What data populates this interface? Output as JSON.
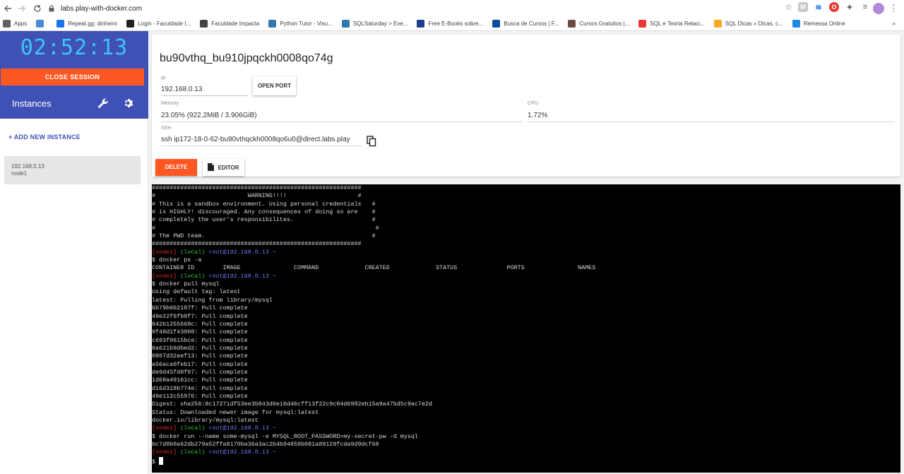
{
  "browser": {
    "url": "labs.play-with-docker.com",
    "bookmarks": [
      {
        "label": "Apps",
        "color": "#5f6368"
      },
      {
        "label": "",
        "color": "#4a8bd6"
      },
      {
        "label": "Repeat.gg: dinheiro",
        "color": "#1a73e8"
      },
      {
        "label": "Login - Faculdade I...",
        "color": "#202124"
      },
      {
        "label": "Faculdade Impacta",
        "color": "#444"
      },
      {
        "label": "Python Tutor - Visu...",
        "color": "#3776ab"
      },
      {
        "label": "SQLSaturday > Eve...",
        "color": "#2a7ab0"
      },
      {
        "label": "Free E-Books sobre...",
        "color": "#1b3f8b"
      },
      {
        "label": "Busca de Cursos | F...",
        "color": "#0b4f9c"
      },
      {
        "label": "Cursos Gratuitos |...",
        "color": "#6d4c41"
      },
      {
        "label": "SQL e Teoria Relaci...",
        "color": "#e53935"
      },
      {
        "label": "SQL Dicas » Dicas, c...",
        "color": "#f9a825"
      },
      {
        "label": "Remessa Online",
        "color": "#1e88e5"
      }
    ]
  },
  "sidebar": {
    "timer": "02:52:13",
    "close_session": "CLOSE SESSION",
    "instances_title": "Instances",
    "add_instance": "+ ADD NEW INSTANCE",
    "instance": {
      "ip": "192.168.0.13",
      "name": "node1"
    }
  },
  "instance": {
    "hostname": "bu90vthq_bu910jpqckh0008qo74g",
    "ip_label": "IP",
    "ip": "192.168.0.13",
    "open_port": "OPEN PORT",
    "memory_label": "Memory",
    "memory": "23.05% (922.2MiB / 3.906GiB)",
    "cpu_label": "CPU",
    "cpu": "1.72%",
    "ssh_label": "SSH",
    "ssh": "ssh ip172-18-0-62-bu90vthqckh0008qo6u0@direct.labs.play",
    "delete": "DELETE",
    "editor": "EDITOR"
  },
  "terminal": {
    "banner": [
      "###########################################################",
      "#                          WARNING!!!!                    #",
      "# This is a sandbox environment. Using personal credentials   #",
      "# is HIGHLY! discouraged. Any consequences of doing so are    #",
      "# completely the user's responsibilites.                      #",
      "#                                                              #",
      "# The PWD team.                                               #",
      "###########################################################"
    ],
    "prompt": {
      "node": "[node1]",
      "local": "(local)",
      "user": "root@192.168.0.13",
      "tilde": "~"
    },
    "blocks": [
      {
        "cmd": "$ docker ps -a",
        "output": [
          "CONTAINER ID        IMAGE               COMMAND             CREATED             STATUS              PORTS               NAMES"
        ]
      },
      {
        "cmd": "$ docker pull mysql",
        "output": [
          "Using default tag: latest",
          "latest: Pulling from library/mysql",
          "bb79b6b2107f: Pull complete",
          "49e22f6fb9f7: Pull complete",
          "842b1255668c: Pull complete",
          "9f48d1f43000: Pull complete",
          "c693f0615bce: Pull complete",
          "8a621b9dbed2: Pull complete",
          "0807d32aef13: Pull complete",
          "a56aca0feb17: Pull complete",
          "de9d45fd0f07: Pull complete",
          "1d68a49161cc: Pull complete",
          "d16d318b774e: Pull complete",
          "49e112c55976: Pull complete",
          "Digest: sha256:8c17271df53ee3b843d6e16d46cff13f22c9c04d6982eb15a9a47bd5c9ac7e2d",
          "Status: Downloaded newer image for mysql:latest",
          "docker.io/library/mysql:latest"
        ]
      },
      {
        "cmd": "$ docker run --name some-mysql -e MYSQL_ROOT_PASSWORD=my-secret-pw -d mysql",
        "output": [
          "bc7d0b0a62db279a52ffa8170ba36a3ac2b4b94859b081a89129fcda9d9dcf68"
        ]
      }
    ],
    "final_prompt": "$ "
  }
}
